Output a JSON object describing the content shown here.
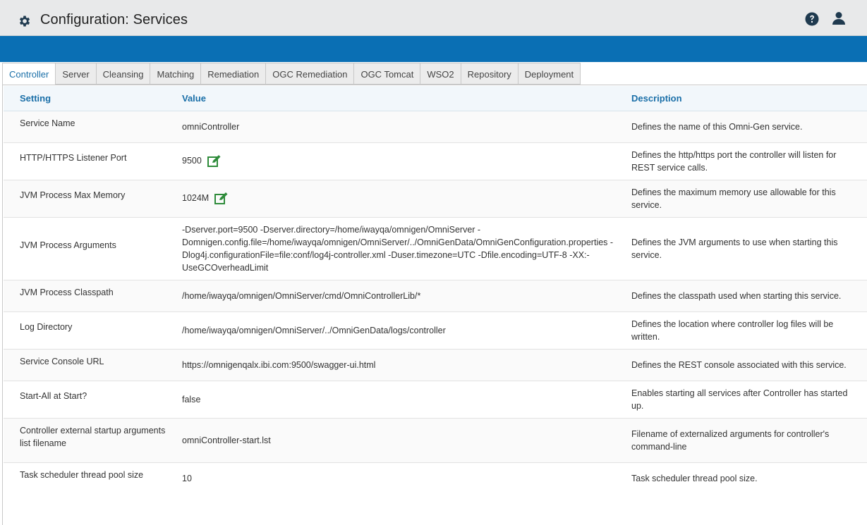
{
  "header": {
    "title": "Configuration: Services",
    "icons": {
      "settings": "gear-icon",
      "help": "question-circle-icon",
      "user": "user-icon"
    }
  },
  "colors": {
    "accent_bar": "#0a6fb4",
    "header_text": "#1a6fa8",
    "edit_icon": "#2e8b3a"
  },
  "tabs": [
    {
      "label": "Controller",
      "active": true
    },
    {
      "label": "Server"
    },
    {
      "label": "Cleansing"
    },
    {
      "label": "Matching"
    },
    {
      "label": "Remediation"
    },
    {
      "label": "OGC Remediation"
    },
    {
      "label": "OGC Tomcat"
    },
    {
      "label": "WSO2"
    },
    {
      "label": "Repository"
    },
    {
      "label": "Deployment"
    }
  ],
  "table": {
    "columns": {
      "setting": "Setting",
      "value": "Value",
      "description": "Description"
    },
    "rows": [
      {
        "setting": "Service Name",
        "value": "omniController",
        "description": "Defines the name of this Omni-Gen service."
      },
      {
        "setting": "HTTP/HTTPS Listener Port",
        "value": "9500",
        "description": "Defines the http/https port the controller will listen for REST service calls.",
        "editable": true
      },
      {
        "setting": "JVM Process Max Memory",
        "value": "1024M",
        "description": "Defines the maximum memory use allowable for this service.",
        "editable": true
      },
      {
        "setting": "JVM Process Arguments",
        "value": "-Dserver.port=9500 -Dserver.directory=/home/iwayqa/omnigen/OmniServer -Domnigen.config.file=/home/iwayqa/omnigen/OmniServer/../OmniGenData/OmniGenConfiguration.properties -Dlog4j.configurationFile=file:conf/log4j-controller.xml -Duser.timezone=UTC -Dfile.encoding=UTF-8 -XX:-UseGCOverheadLimit",
        "description": "Defines the JVM arguments to use when starting this service."
      },
      {
        "setting": "JVM Process Classpath",
        "value": "/home/iwayqa/omnigen/OmniServer/cmd/OmniControllerLib/*",
        "description": "Defines the classpath used when starting this service."
      },
      {
        "setting": "Log Directory",
        "value": "/home/iwayqa/omnigen/OmniServer/../OmniGenData/logs/controller",
        "description": "Defines the location where controller log files will be written."
      },
      {
        "setting": "Service Console URL",
        "value": "https://omnigenqalx.ibi.com:9500/swagger-ui.html",
        "description": "Defines the REST console associated with this service."
      },
      {
        "setting": "Start-All at Start?",
        "value": "false",
        "description": "Enables starting all services after Controller has started up."
      },
      {
        "setting": "Controller external startup arguments list filename",
        "value": "omniController-start.lst",
        "description": "Filename of externalized arguments for controller's command-line"
      },
      {
        "setting": "Task scheduler thread pool size",
        "value": "10",
        "description": "Task scheduler thread pool size."
      }
    ]
  }
}
